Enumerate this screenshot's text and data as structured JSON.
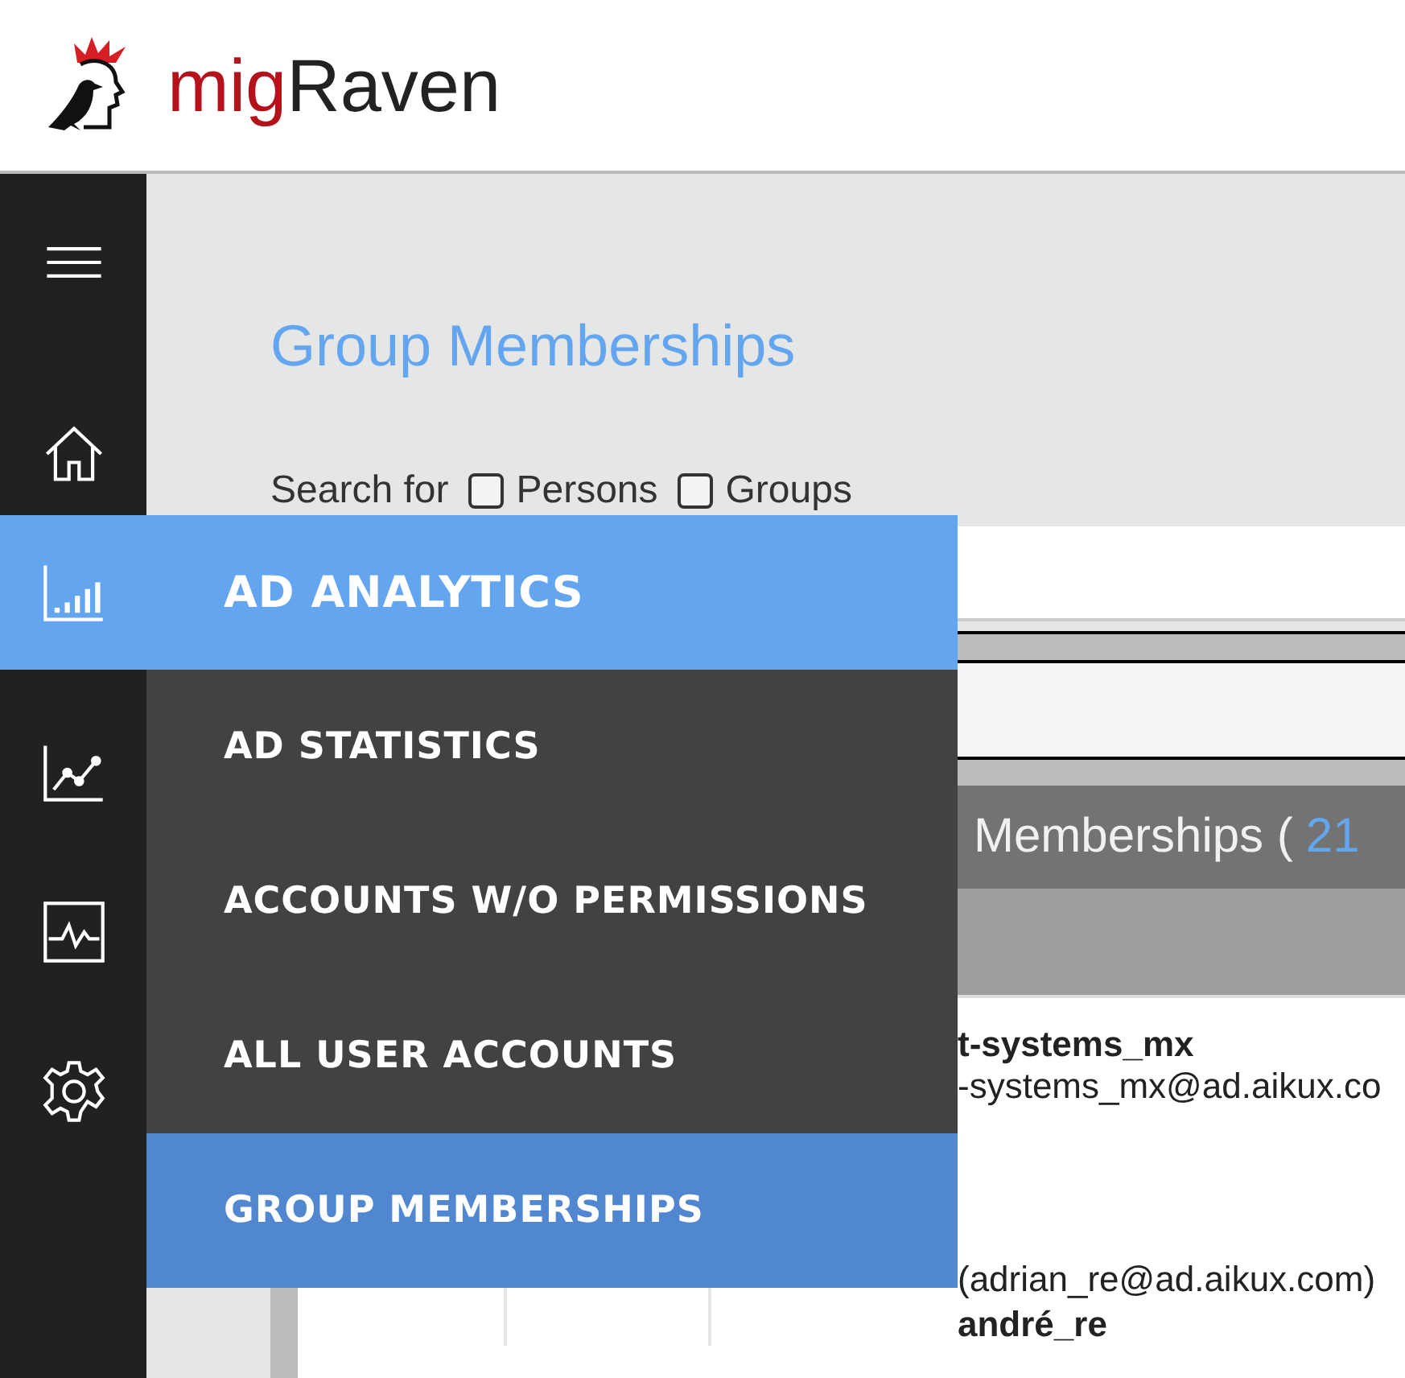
{
  "header": {
    "logo_text": [
      {
        "text": "mig",
        "kind": "accent"
      },
      {
        "text": "Raven",
        "kind": "plain"
      }
    ]
  },
  "page": {
    "title": "Group Memberships",
    "search": {
      "label": "Search for",
      "options": [
        {
          "label": "Persons",
          "checked": false
        },
        {
          "label": "Groups",
          "checked": false
        }
      ]
    },
    "table": {
      "header_label": "Memberships (",
      "count": "21",
      "rows": [
        {
          "name": "t-systems_mx",
          "email": "-systems_mx@ad.aikux.co"
        },
        {
          "email": "(adrian_re@ad.aikux.com)"
        },
        {
          "name": "andré_re"
        }
      ]
    }
  },
  "flyout": {
    "title": "AD ANALYTICS",
    "items": [
      {
        "label": "AD STATISTICS",
        "selected": false
      },
      {
        "label": "ACCOUNTS W/O PERMISSIONS",
        "selected": false
      },
      {
        "label": "ALL USER ACCOUNTS",
        "selected": false
      },
      {
        "label": "GROUP MEMBERSHIPS",
        "selected": true
      }
    ]
  }
}
